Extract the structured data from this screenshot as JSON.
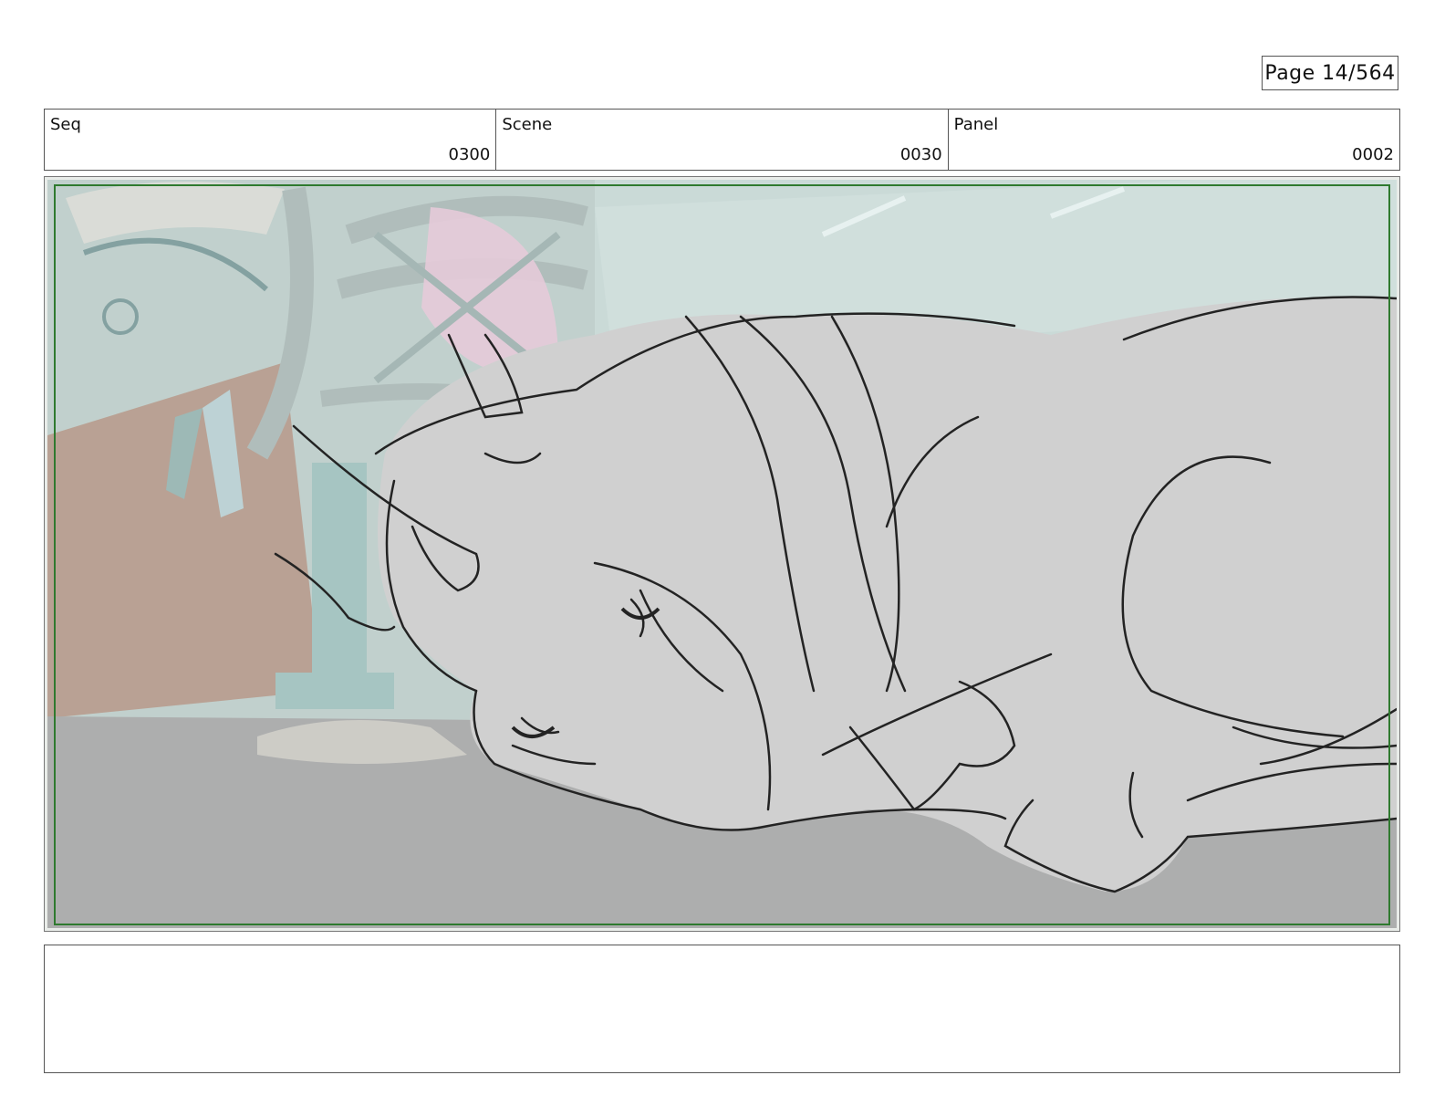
{
  "page": {
    "label": "Page  14/564"
  },
  "header": {
    "seq": {
      "label": "Seq",
      "value": "0300"
    },
    "scene": {
      "label": "Scene",
      "value": "0030"
    },
    "panel": {
      "label": "Panel",
      "value": "0002"
    }
  },
  "panel_image": {
    "description_icon": "storyboard-sketch-image",
    "safe_frame_color": "#2f7a2f"
  },
  "notes": {
    "text": ""
  }
}
